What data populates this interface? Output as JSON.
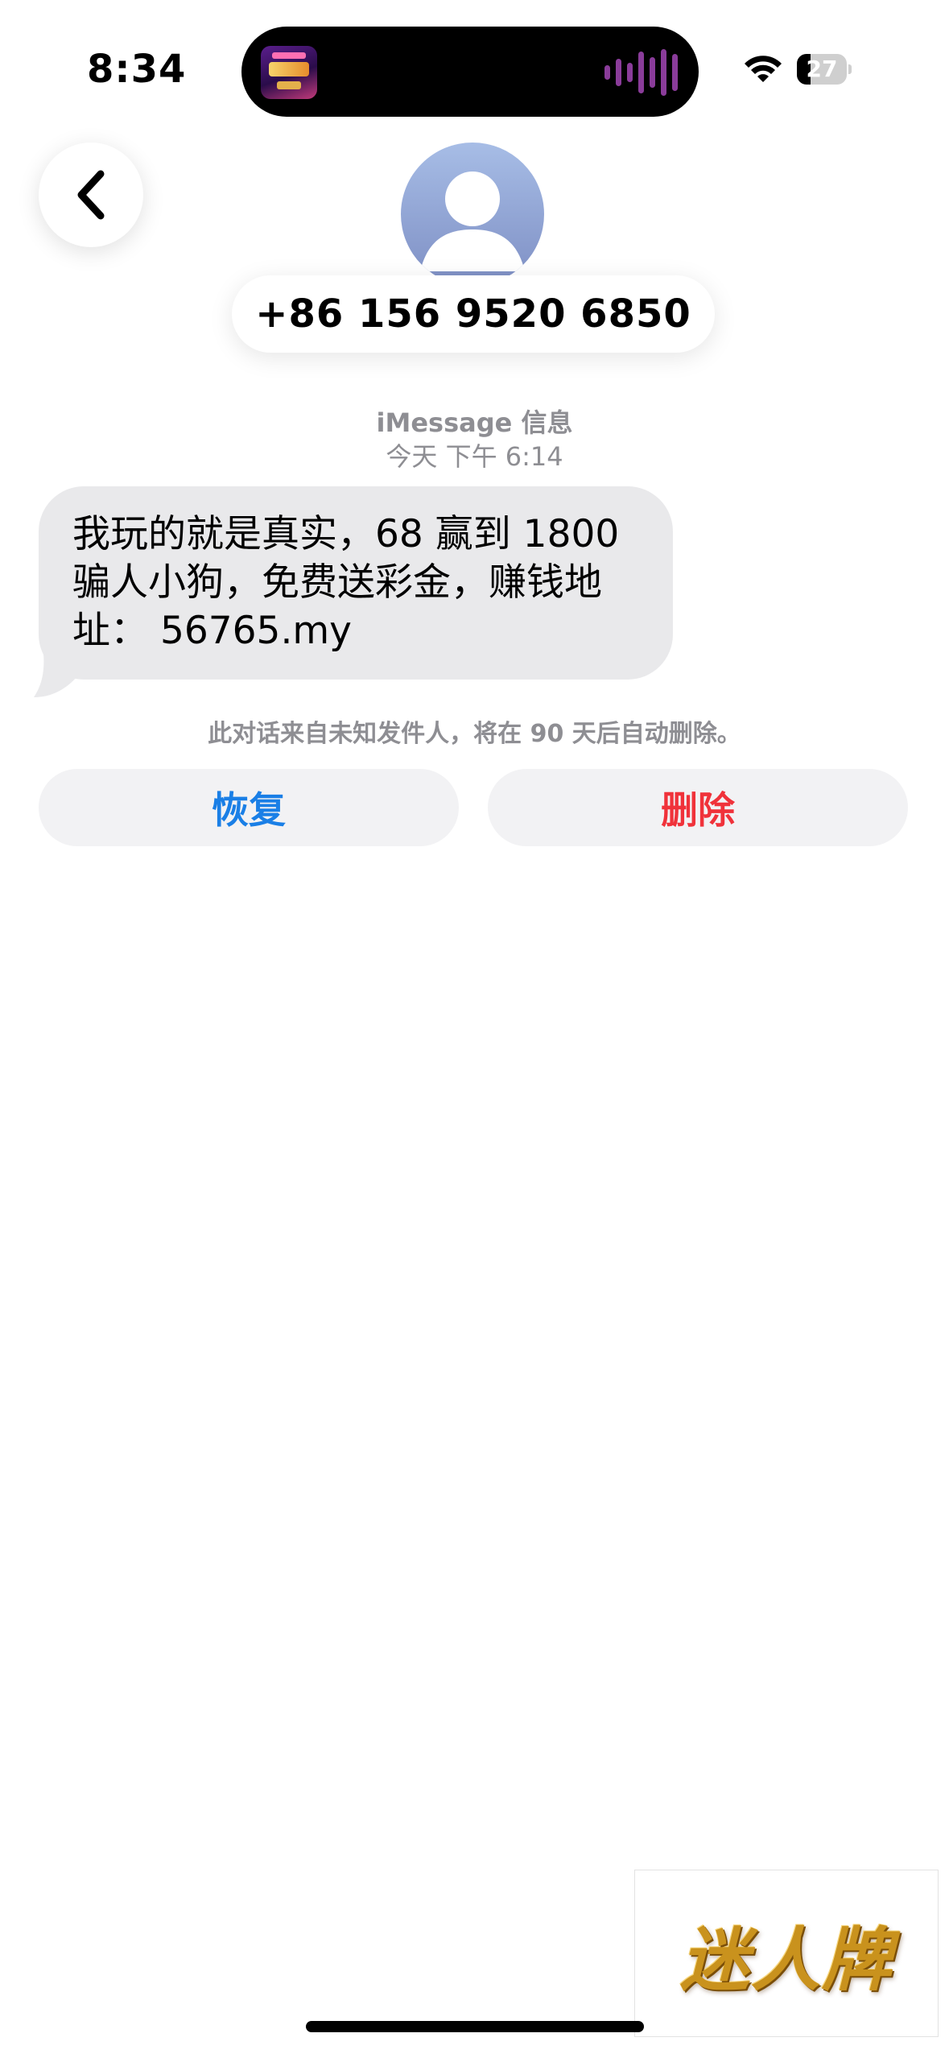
{
  "status_bar": {
    "time": "8:34",
    "battery_level": "27",
    "battery_fraction": 0.27,
    "wifi_icon": "wifi-icon",
    "now_playing_icon": "album-art-icon",
    "waveform_icon": "audio-waveform-icon"
  },
  "header": {
    "back_icon": "chevron-left-icon",
    "avatar_icon": "person-silhouette-icon",
    "contact_name": "+86 156 9520 6850"
  },
  "conversation": {
    "service": "iMessage 信息",
    "timestamp": "今天 下午 6:14",
    "messages": [
      {
        "direction": "incoming",
        "text": "我玩的就是真实，68 赢到 1800 骗人小狗，免费送彩金，赚钱地址： 56765.my"
      }
    ],
    "notice": "此对话来自未知发件人，将在 90 天后自动删除。"
  },
  "actions": {
    "restore_label": "恢复",
    "delete_label": "删除"
  },
  "watermark": {
    "text": "迷人牌"
  },
  "colors": {
    "bubble_incoming": "#e9e9eb",
    "restore": "#1a7fe6",
    "delete": "#f0323a",
    "secondary_text": "#8e8e93"
  }
}
